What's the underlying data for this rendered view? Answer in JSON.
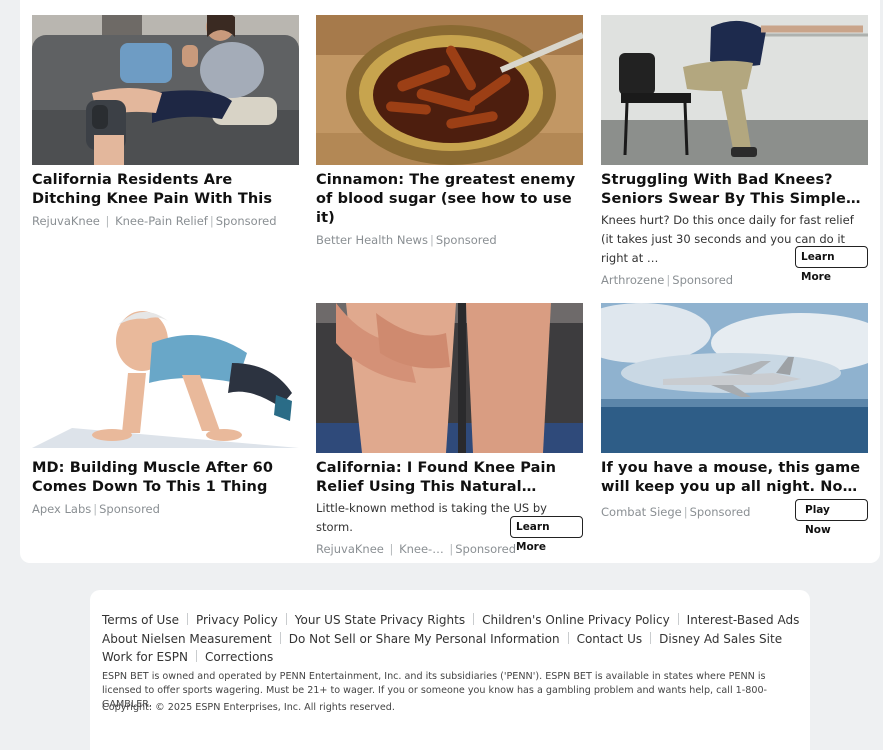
{
  "ads": [
    {
      "title": "California Residents Are Ditching Knee Pain With This",
      "desc": "",
      "source": "RejuvaKnee",
      "sub": "Knee-Pain Relief",
      "sponsored": "Sponsored",
      "cta": ""
    },
    {
      "title": "Cinnamon: The greatest enemy of blood sugar (see how to use it)",
      "desc": "",
      "source": "Better Health News",
      "sub": "",
      "sponsored": "Sponsored",
      "cta": ""
    },
    {
      "title": "Struggling With Bad Knees? Seniors Swear By This Simple…",
      "desc": "Knees hurt? Do this once daily for fast relief (it takes just 30 seconds and you can do it right at …",
      "source": "Arthrozene",
      "sub": "",
      "sponsored": "Sponsored",
      "cta": "Learn More"
    },
    {
      "title": "MD: Building Muscle After 60 Comes Down To This 1 Thing",
      "desc": "",
      "source": "Apex Labs",
      "sub": "",
      "sponsored": "Sponsored",
      "cta": ""
    },
    {
      "title": "California: I Found Knee Pain Relief Using This Natural…",
      "desc": "Little-known method is taking the US by storm.",
      "source": "RejuvaKnee",
      "sub": "Knee-…",
      "sponsored": "Sponsored",
      "cta": "Learn More"
    },
    {
      "title": "If you have a mouse, this game will keep you up all night. No…",
      "desc": "",
      "source": "Combat Siege",
      "sub": "",
      "sponsored": "Sponsored",
      "cta": "Play Now"
    }
  ],
  "footer": {
    "links": [
      "Terms of Use",
      "Privacy Policy",
      "Your US State Privacy Rights",
      "Children's Online Privacy Policy",
      "Interest-Based Ads",
      "About Nielsen Measurement",
      "Do Not Sell or Share My Personal Information",
      "Contact Us",
      "Disney Ad Sales Site",
      "Work for ESPN",
      "Corrections"
    ],
    "legal": "ESPN BET is owned and operated by PENN Entertainment, Inc. and its subsidiaries ('PENN'). ESPN BET is available in states where PENN is licensed to offer sports wagering. Must be 21+ to wager. If you or someone you know has a gambling problem and wants help, call 1-800-GAMBLER.",
    "copyright": "Copyright: © 2025 ESPN Enterprises, Inc. All rights reserved."
  }
}
